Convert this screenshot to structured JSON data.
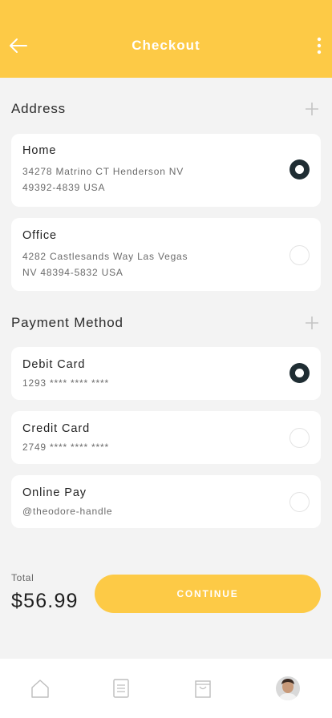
{
  "header": {
    "title": "Checkout",
    "background": "#fdca46"
  },
  "address": {
    "section_title": "Address",
    "items": [
      {
        "label": "Home",
        "line1": "34278 Matrino CT Henderson NV",
        "line2": "49392-4839 USA",
        "selected": true
      },
      {
        "label": "Office",
        "line1": "4282 Castlesands Way Las Vegas",
        "line2": "NV 48394-5832 USA",
        "selected": false
      }
    ]
  },
  "payment": {
    "section_title": "Payment Method",
    "items": [
      {
        "label": "Debit Card",
        "detail": "1293 **** **** ****",
        "selected": true
      },
      {
        "label": "Credit Card",
        "detail": "2749 **** **** ****",
        "selected": false
      },
      {
        "label": "Online Pay",
        "detail": "@theodore-handle",
        "selected": false
      }
    ]
  },
  "summary": {
    "total_label": "Total",
    "total_value": "$56.99",
    "continue_label": "CONTINUE"
  },
  "nav": {
    "items": [
      "home-icon",
      "list-icon",
      "bag-icon",
      "avatar"
    ]
  },
  "colors": {
    "accent": "#fdca46",
    "selected_radio": "#1f2d33"
  }
}
